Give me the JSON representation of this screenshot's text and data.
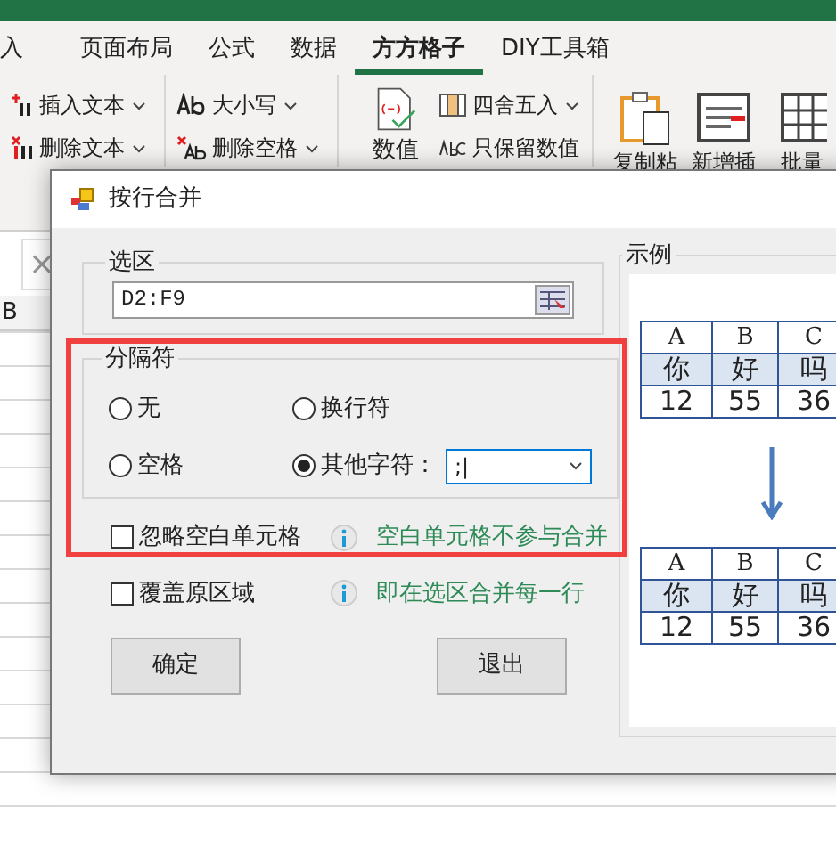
{
  "ribbon_tabs": [
    {
      "label": "入",
      "selected": false
    },
    {
      "label": "页面布局",
      "selected": false
    },
    {
      "label": "公式",
      "selected": false
    },
    {
      "label": "数据",
      "selected": false
    },
    {
      "label": "方方格子",
      "selected": true
    },
    {
      "label": "DIY工具箱",
      "selected": false
    }
  ],
  "ribbon": {
    "text_tools": [
      {
        "label": "插入文本",
        "dropdown": true
      },
      {
        "label": "删除文本",
        "dropdown": true
      }
    ],
    "case_tools": [
      {
        "label": "大小写",
        "dropdown": true
      },
      {
        "label": "删除空格",
        "dropdown": true
      }
    ],
    "number_big": "数值",
    "number_tools": [
      {
        "label": "四舍五入",
        "dropdown": true
      },
      {
        "label": "只保留数值",
        "dropdown": false
      }
    ],
    "large_buttons": [
      "复制粘",
      "新增插",
      "批量"
    ]
  },
  "sheet": {
    "cancel_mark": "×",
    "column_header": "B"
  },
  "dialog": {
    "title": "按行合并",
    "selection": {
      "label": "选区",
      "value": "D2:F9"
    },
    "separator": {
      "label": "分隔符",
      "options": [
        {
          "label": "无",
          "selected": false
        },
        {
          "label": "换行符",
          "selected": false
        },
        {
          "label": "空格",
          "selected": false
        },
        {
          "label": "其他字符：",
          "selected": true
        }
      ],
      "other_value": ";|"
    },
    "checks": [
      {
        "label": "忽略空白单元格",
        "checked": false,
        "hint": "空白单元格不参与合并"
      },
      {
        "label": "覆盖原区域",
        "checked": false,
        "hint": "即在选区合并每一行"
      }
    ],
    "buttons": [
      "确定",
      "退出"
    ],
    "example": {
      "label": "示例",
      "tables": [
        {
          "header": [
            "A",
            "B",
            "C"
          ],
          "rows": [
            [
              "你",
              "好",
              "吗"
            ],
            [
              "12",
              "55",
              "36"
            ]
          ]
        },
        {
          "header": [
            "A",
            "B",
            "C"
          ],
          "rows": [
            [
              "你",
              "好",
              "吗"
            ],
            [
              "12",
              "55",
              "36"
            ]
          ]
        }
      ]
    }
  }
}
